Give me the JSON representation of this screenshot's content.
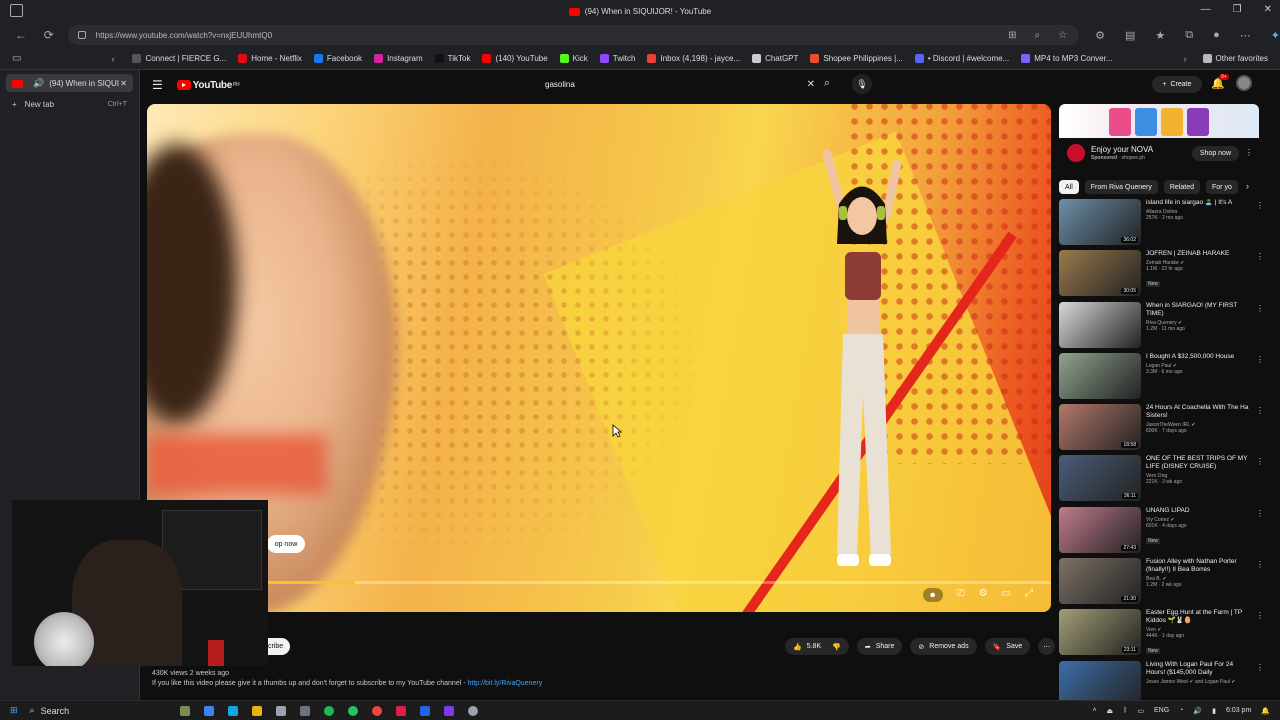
{
  "window": {
    "title": "(94) When in SIQUIJOR! - YouTube"
  },
  "address": {
    "url": "https://www.youtube.com/watch?v=nxjEUUhmtQ0"
  },
  "bookmarks": [
    {
      "label": "Connect | FIERCE G...",
      "color": "#555555"
    },
    {
      "label": "Home - Netflix",
      "color": "#e50914"
    },
    {
      "label": "Facebook",
      "color": "#1877f2"
    },
    {
      "label": "Instagram",
      "color": "#d6249f"
    },
    {
      "label": "TikTok",
      "color": "#111111"
    },
    {
      "label": "(140) YouTube",
      "color": "#ff0000"
    },
    {
      "label": "Kick",
      "color": "#53fc18"
    },
    {
      "label": "Twitch",
      "color": "#9146ff"
    },
    {
      "label": "Inbox (4,198) - jayce...",
      "color": "#ea4335"
    },
    {
      "label": "ChatGPT",
      "color": "#cccccc"
    },
    {
      "label": "Shopee Philippines |...",
      "color": "#ee4d2d"
    },
    {
      "label": "• Discord | #welcome...",
      "color": "#5865f2"
    },
    {
      "label": "MP4 to MP3 Conver...",
      "color": "#7b61ff"
    }
  ],
  "other_favorites": "Other favorites",
  "sidebar": {
    "active_tab": "(94) When in SIQUI",
    "new_tab": "New tab",
    "new_tab_shortcut": "Ctrl+T"
  },
  "youtube": {
    "logo": "YouTube",
    "logo_region": "PH",
    "search_value": "gasolina",
    "create_label": "Create",
    "notif_count": "9+"
  },
  "video": {
    "shop_now": "op now",
    "subscribe_fragment": "cribe",
    "progress": 0.23
  },
  "actions": {
    "likes": "5.8K",
    "share": "Share",
    "remove_ads": "Remove ads",
    "save": "Save"
  },
  "description": {
    "meta": "430K views  2 weeks ago",
    "text": "If you like this video please give it a thumbs up and don't forget to subscribe to my YouTube channel - ",
    "link": "http://bit.ly/RivaQuenery"
  },
  "ad": {
    "title": "Enjoy your NOVA",
    "sponsored": "Sponsored",
    "domain": "· shopee.ph",
    "cta": "Shop now"
  },
  "chips": [
    "All",
    "From Riva Quenery",
    "Related",
    "For yo"
  ],
  "recommendations": [
    {
      "title": "island life in siargao 🏝️ | It's A",
      "channel": "Allaera Dolina",
      "meta": "257K · 2 mo ago",
      "duration": "36:02",
      "new": "",
      "color": "#6e8fa8"
    },
    {
      "title": "JOFREN | ZEINAB HARAKE",
      "channel": "Zeinab Harake ✔",
      "meta": "1.1M · 22 hr ago",
      "duration": "30:05",
      "new": "New",
      "color": "#9a7a4c"
    },
    {
      "title": "When in SIARGAO! (MY FIRST TIME)",
      "channel": "Riva Quenery ✔",
      "meta": "1.2M · 11 mo ago",
      "duration": "",
      "new": "",
      "color": "#d8d8d8"
    },
    {
      "title": "I Bought A $32,500,000 House",
      "channel": "Logan Paul ✔",
      "meta": "3.3M · 6 mo ago",
      "duration": "",
      "new": "",
      "color": "#8fa38f"
    },
    {
      "title": "24 Hours At Coachella With The Ha Sisters!",
      "channel": "JasonTheWeen IRL ✔",
      "meta": "600K · 7 days ago",
      "duration": "18:58",
      "new": "",
      "color": "#b3786a"
    },
    {
      "title": "ONE OF THE BEST TRIPS OF MY LIFE (DISNEY CRUISE)",
      "channel": "Vern Ong",
      "meta": "221K · 3 wk ago",
      "duration": "36:11",
      "new": "",
      "color": "#4b5d7a"
    },
    {
      "title": "UNANG LIPAD",
      "channel": "Viy Cortez ✔",
      "meta": "601K · 4 days ago",
      "duration": "27:43",
      "new": "New",
      "color": "#c07b8d"
    },
    {
      "title": "Fusion Alley with Nathan Porter (finally!!) II Bea Borres",
      "channel": "Bea B. ✔",
      "meta": "1.2M · 2 wk ago",
      "duration": "21:30",
      "new": "",
      "color": "#7d7266"
    },
    {
      "title": "Easter Egg Hunt at the Farm | TP Kiddos 🌱🐰🥚",
      "channel": "Vien ✔",
      "meta": "444K · 1 day ago",
      "duration": "23:11",
      "new": "New",
      "color": "#a39e76"
    },
    {
      "title": "Living With Logan Paul For 24 Hours! ($145,000 Daily",
      "channel": "Jesse James West ✔ and Logan Paul ✔",
      "meta": "",
      "duration": "",
      "new": "",
      "color": "#3c6ea8"
    }
  ],
  "taskbar": {
    "search": "Search",
    "lang": "ENG",
    "time": "6:03 pm"
  },
  "colors": {
    "yt_red": "#ff0000",
    "progress_yellow": "#fbc02d"
  }
}
